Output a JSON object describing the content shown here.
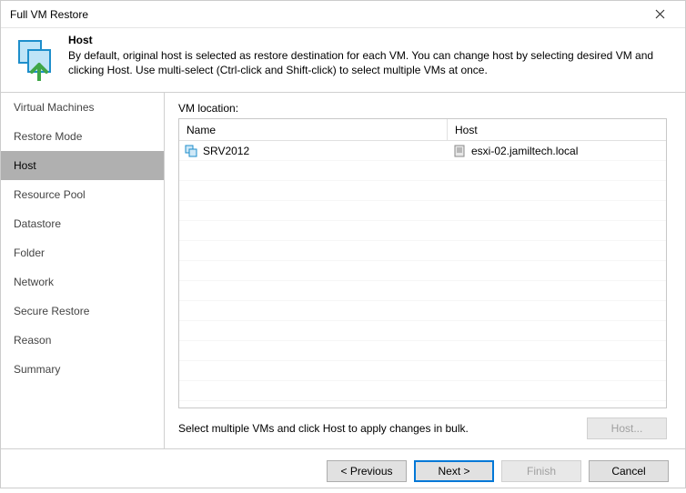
{
  "window": {
    "title": "Full VM Restore"
  },
  "header": {
    "title": "Host",
    "description": "By default, original host is selected as restore destination for each VM. You can change host by selecting desired VM and clicking Host. Use multi-select (Ctrl-click and Shift-click) to select multiple VMs at once."
  },
  "sidebar": {
    "items": [
      "Virtual Machines",
      "Restore Mode",
      "Host",
      "Resource Pool",
      "Datastore",
      "Folder",
      "Network",
      "Secure Restore",
      "Reason",
      "Summary"
    ],
    "active_index": 2
  },
  "main": {
    "label": "VM location:",
    "columns": {
      "name": "Name",
      "host": "Host"
    },
    "rows": [
      {
        "name": "SRV2012",
        "host": "esxi-02.jamiltech.local"
      }
    ],
    "hint": "Select multiple VMs and click Host to apply changes in bulk.",
    "host_button": "Host..."
  },
  "footer": {
    "previous": "< Previous",
    "next": "Next >",
    "finish": "Finish",
    "cancel": "Cancel"
  }
}
